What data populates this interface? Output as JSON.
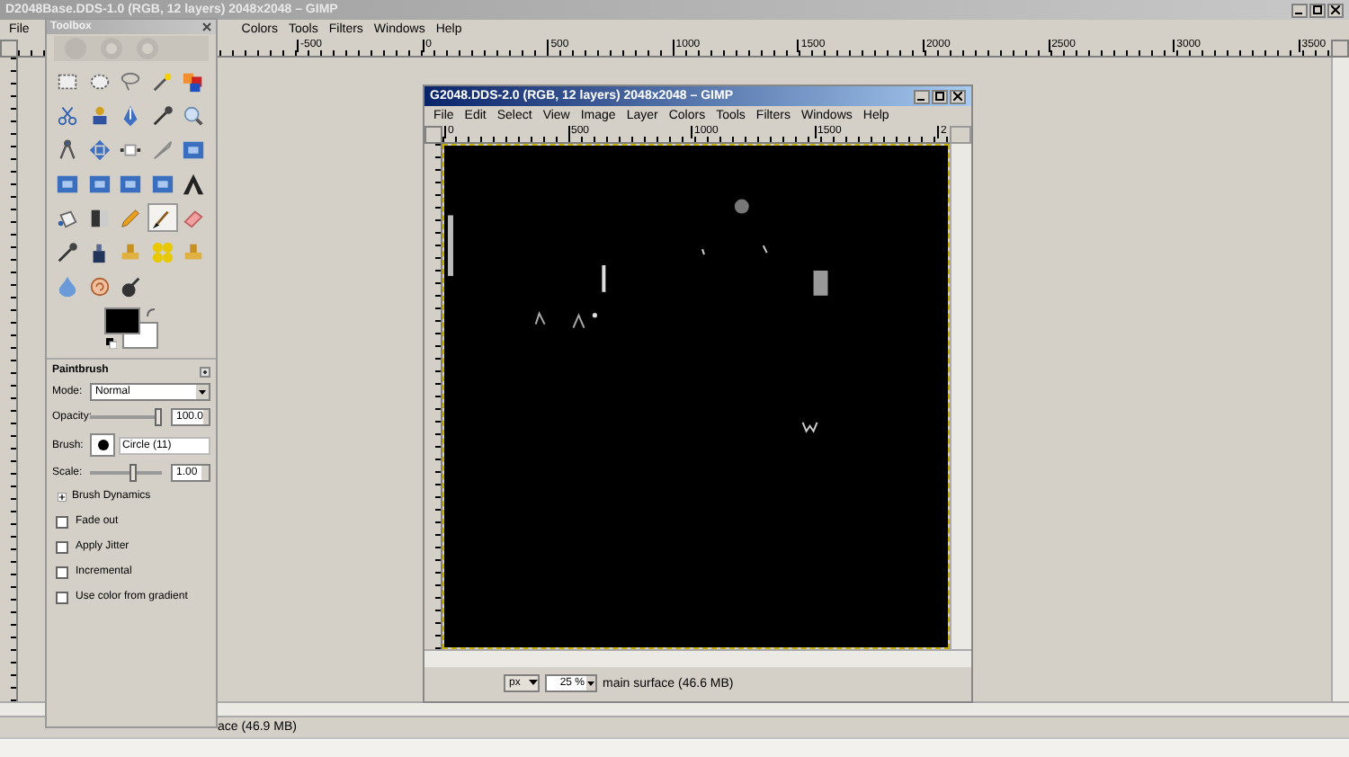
{
  "main_window": {
    "title": "D2048Base.DDS-1.0 (RGB, 12 layers) 2048x2048 – GIMP",
    "active": false,
    "menu": [
      "File",
      "Colors",
      "Tools",
      "Filters",
      "Windows",
      "Help"
    ],
    "ruler_labels": [
      "-500",
      "0",
      "500",
      "1000",
      "1500",
      "2000",
      "2500",
      "3000",
      "3500"
    ],
    "status": "ace (46.9 MB)"
  },
  "toolbox": {
    "title": "Toolbox",
    "tools": [
      {
        "selected": false
      },
      {
        "selected": false
      },
      {
        "selected": false
      },
      {
        "selected": false
      },
      {
        "selected": false
      },
      {
        "selected": false
      },
      {
        "selected": false
      },
      {
        "selected": false
      },
      {
        "selected": false
      },
      {
        "selected": false
      },
      {
        "selected": false
      },
      {
        "selected": false
      },
      {
        "selected": false
      },
      {
        "selected": false
      },
      {
        "selected": false
      },
      {
        "selected": false
      },
      {
        "selected": false
      },
      {
        "selected": false
      },
      {
        "selected": false
      },
      {
        "selected": false
      },
      {
        "selected": false
      },
      {
        "selected": false
      },
      {
        "selected": false
      },
      {
        "selected": true
      },
      {
        "selected": false
      },
      {
        "selected": false
      },
      {
        "selected": false
      },
      {
        "selected": false
      },
      {
        "selected": false
      },
      {
        "selected": false
      },
      {
        "selected": false
      },
      {
        "selected": false
      },
      {
        "selected": false
      }
    ],
    "options": {
      "title": "Paintbrush",
      "mode_label": "Mode:",
      "mode": "Normal",
      "opacity_label": "Opacity:",
      "opacity": {
        "level": 1,
        "value": "100.0"
      },
      "brush_label": "Brush:",
      "brush": "Circle (11)",
      "scale_label": "Scale:",
      "scale": {
        "level": 0.62,
        "value": "1.00"
      },
      "dynamics": {
        "label": "Brush Dynamics",
        "expanded": false
      },
      "checkboxes": [
        {
          "label": "Fade out",
          "checked": false
        },
        {
          "label": "Apply Jitter",
          "checked": false
        },
        {
          "label": "Incremental",
          "checked": false
        },
        {
          "label": "Use color from gradient",
          "checked": false
        }
      ]
    }
  },
  "image_window": {
    "title": "G2048.DDS-2.0 (RGB, 12 layers) 2048x2048 – GIMP",
    "active": true,
    "menu": [
      "File",
      "Edit",
      "Select",
      "View",
      "Image",
      "Layer",
      "Colors",
      "Tools",
      "Filters",
      "Windows",
      "Help"
    ],
    "ruler_labels": [
      "0",
      "500",
      "1000",
      "1500",
      "2"
    ],
    "unit": "px",
    "zoom": "25 %",
    "status": "main surface (46.6 MB)"
  }
}
